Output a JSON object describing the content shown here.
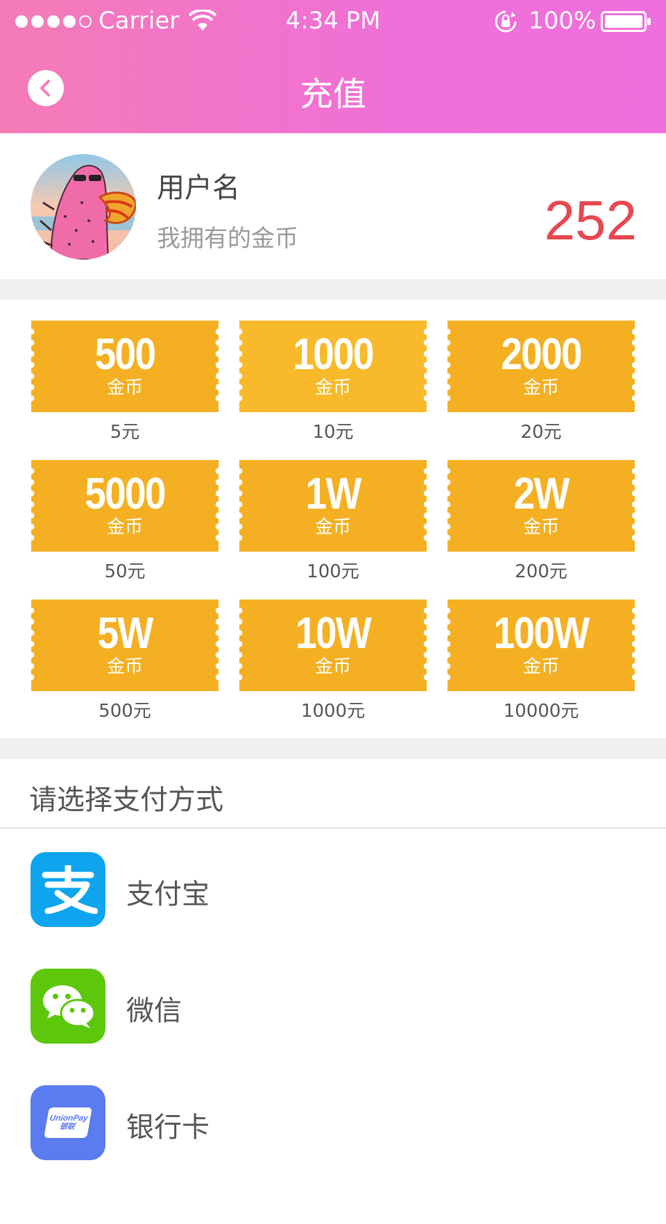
{
  "status_bar": {
    "carrier": "Carrier",
    "time": "4:34 PM",
    "battery": "100%"
  },
  "header": {
    "title": "充值"
  },
  "user": {
    "name": "用户名",
    "coins_label": "我拥有的金币",
    "coins": "252"
  },
  "packages": [
    {
      "amount": "500",
      "unit": "金币",
      "price": "5元"
    },
    {
      "amount": "1000",
      "unit": "金币",
      "price": "10元"
    },
    {
      "amount": "2000",
      "unit": "金币",
      "price": "20元"
    },
    {
      "amount": "5000",
      "unit": "金币",
      "price": "50元"
    },
    {
      "amount": "1W",
      "unit": "金币",
      "price": "100元"
    },
    {
      "amount": "2W",
      "unit": "金币",
      "price": "200元"
    },
    {
      "amount": "5W",
      "unit": "金币",
      "price": "500元"
    },
    {
      "amount": "10W",
      "unit": "金币",
      "price": "1000元"
    },
    {
      "amount": "100W",
      "unit": "金币",
      "price": "10000元"
    }
  ],
  "payment": {
    "title": "请选择支付方式",
    "methods": [
      {
        "label": "支付宝",
        "icon": "alipay-icon",
        "color": "#0ea5ee"
      },
      {
        "label": "微信",
        "icon": "wechat-icon",
        "color": "#5cc70b"
      },
      {
        "label": "银行卡",
        "icon": "unionpay-icon",
        "color": "#5b7bf0",
        "icon_text_en": "UnionPay",
        "icon_text_cn": "银联"
      }
    ]
  },
  "colors": {
    "header_start": "#f47bb6",
    "header_end": "#ee70dc",
    "ticket": "#f4b022",
    "coin_count": "#e8474f"
  }
}
